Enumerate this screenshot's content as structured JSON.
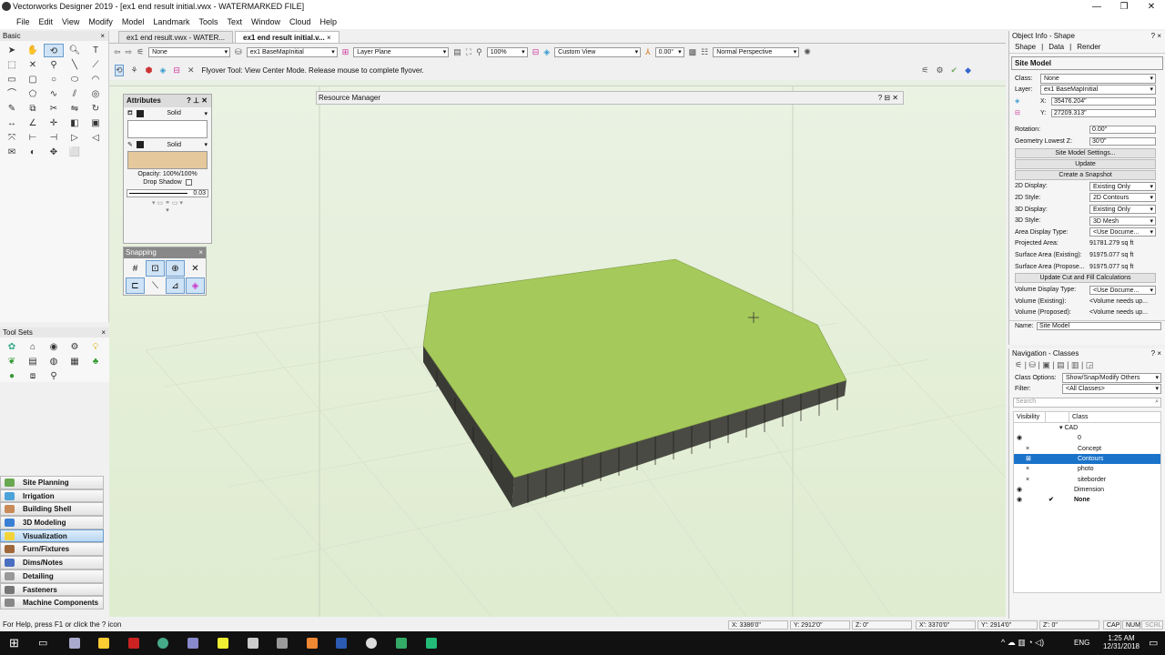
{
  "window": {
    "title": "Vectorworks Designer 2019 - [ex1 end result initial.vwx - WATERMARKED FILE]",
    "controls": [
      "—",
      "❐",
      "✕"
    ]
  },
  "menu": [
    "File",
    "Edit",
    "View",
    "Modify",
    "Model",
    "Landmark",
    "Tools",
    "Text",
    "Window",
    "Cloud",
    "Help"
  ],
  "basic_palette": {
    "title": "Basic",
    "close": "×"
  },
  "tool_sets": {
    "title": "Tool Sets",
    "close": "×"
  },
  "workspaces": [
    {
      "label": "Site Planning",
      "color": "#6aa84f"
    },
    {
      "label": "Irrigation",
      "color": "#4ba3d9"
    },
    {
      "label": "Building Shell",
      "color": "#c98a5a"
    },
    {
      "label": "3D Modeling",
      "color": "#3b7fd4"
    },
    {
      "label": "Visualization",
      "color": "#f2d43a",
      "active": true
    },
    {
      "label": "Furn/Fixtures",
      "color": "#a0683a"
    },
    {
      "label": "Dims/Notes",
      "color": "#4a6fc0"
    },
    {
      "label": "Detailing",
      "color": "#999999"
    },
    {
      "label": "Fasteners",
      "color": "#777777"
    },
    {
      "label": "Machine Components",
      "color": "#888888"
    }
  ],
  "tabs": [
    {
      "label": "ex1 end result.vwx - WATER..."
    },
    {
      "label": "ex1 end result initial.v...",
      "close": "×",
      "active": true
    }
  ],
  "viewbar": {
    "class": "None",
    "layer": "ex1 BaseMapInitial",
    "plane": "Layer Plane",
    "zoom": "100%",
    "view": "Custom View",
    "angle": "0.00°",
    "render": "Normal Perspective"
  },
  "modebar": {
    "message": "Flyover Tool: View Center Mode. Release mouse to complete flyover."
  },
  "resource_manager": {
    "title": "Resource Manager"
  },
  "attributes": {
    "title": "Attributes",
    "fill_style": "Solid",
    "pen_style": "Solid",
    "opacity": "Opacity: 100%/100%",
    "drop_shadow": "Drop Shadow",
    "line_weight": "0.03",
    "fill_color": "#ffffff",
    "pen_color": "#e5c89b"
  },
  "snapping": {
    "title": "Snapping"
  },
  "object_info": {
    "title": "Object Info - Shape",
    "tabs": [
      "Shape",
      "Data",
      "Render"
    ],
    "object_type": "Site Model",
    "class_label": "Class:",
    "class": "None",
    "layer_label": "Layer:",
    "layer": "ex1 BaseMapInitial",
    "x_label": "X:",
    "x": "35476.204\"",
    "y_label": "Y:",
    "y": "27209.313\"",
    "fields": [
      {
        "label": "Rotation:",
        "value": "0.00°"
      },
      {
        "label": "Geometry Lowest Z:",
        "value": "30'0\""
      }
    ],
    "buttons": [
      "Site Model Settings...",
      "Update",
      "Create a Snapshot"
    ],
    "fields2": [
      {
        "label": "2D Display:",
        "value": "Existing Only",
        "dropdown": true
      },
      {
        "label": "2D Style:",
        "value": "2D Contours",
        "dropdown": true
      },
      {
        "label": "3D Display:",
        "value": "Existing Only",
        "dropdown": true
      },
      {
        "label": "3D Style:",
        "value": "3D Mesh",
        "dropdown": true
      },
      {
        "label": "Area Display Type:",
        "value": "<Use Docume...",
        "dropdown": true
      },
      {
        "label": "Projected Area:",
        "value": "91781.279 sq ft"
      },
      {
        "label": "Surface Area (Existing):",
        "value": "91975.077 sq ft"
      },
      {
        "label": "Surface Area (Propose...",
        "value": "91975.077 sq ft"
      }
    ],
    "cutfill_button": "Update Cut and Fill Calculations",
    "fields3": [
      {
        "label": "Volume Display Type:",
        "value": "<Use Docume...",
        "dropdown": true
      },
      {
        "label": "Volume (Existing):",
        "value": "<Volume needs up..."
      },
      {
        "label": "Volume (Proposed):",
        "value": "<Volume needs up..."
      }
    ],
    "name_label": "Name:",
    "name": "Site Model"
  },
  "navigation": {
    "title": "Navigation - Classes",
    "class_options_label": "Class Options:",
    "class_options": "Show/Snap/Modify Others",
    "filter_label": "Filter:",
    "filter": "<All Classes>",
    "search_placeholder": "Search",
    "col_visibility": "Visibility",
    "col_class": "Class",
    "rows": [
      {
        "name": "▾ CAD",
        "indent": 0,
        "vis": ""
      },
      {
        "name": "0",
        "indent": 1,
        "vis": "eye"
      },
      {
        "name": "Concept",
        "indent": 1,
        "vis": "×"
      },
      {
        "name": "Contours",
        "indent": 1,
        "vis": "⊠",
        "selected": true
      },
      {
        "name": "photo",
        "indent": 1,
        "vis": "×"
      },
      {
        "name": "siteborder",
        "indent": 1,
        "vis": "×"
      },
      {
        "name": "Dimension",
        "indent": 0,
        "vis": "eye"
      },
      {
        "name": "None",
        "indent": 0,
        "vis": "eye",
        "active": "✔"
      }
    ]
  },
  "status": {
    "help": "For Help, press F1 or click the ? icon",
    "x": "X: 3386'0\"",
    "y": "Y: 2912'0\"",
    "z": "Z: 0\"",
    "x2": "X': 3370'0\"",
    "y2": "Y': 2914'0\"",
    "z2": "Z': 0\"",
    "cap": "CAP",
    "num": "NUM",
    "scrl": "SCRL"
  },
  "taskbar": {
    "lang": "ENG",
    "time": "1:25 AM",
    "date": "12/31/2018"
  }
}
